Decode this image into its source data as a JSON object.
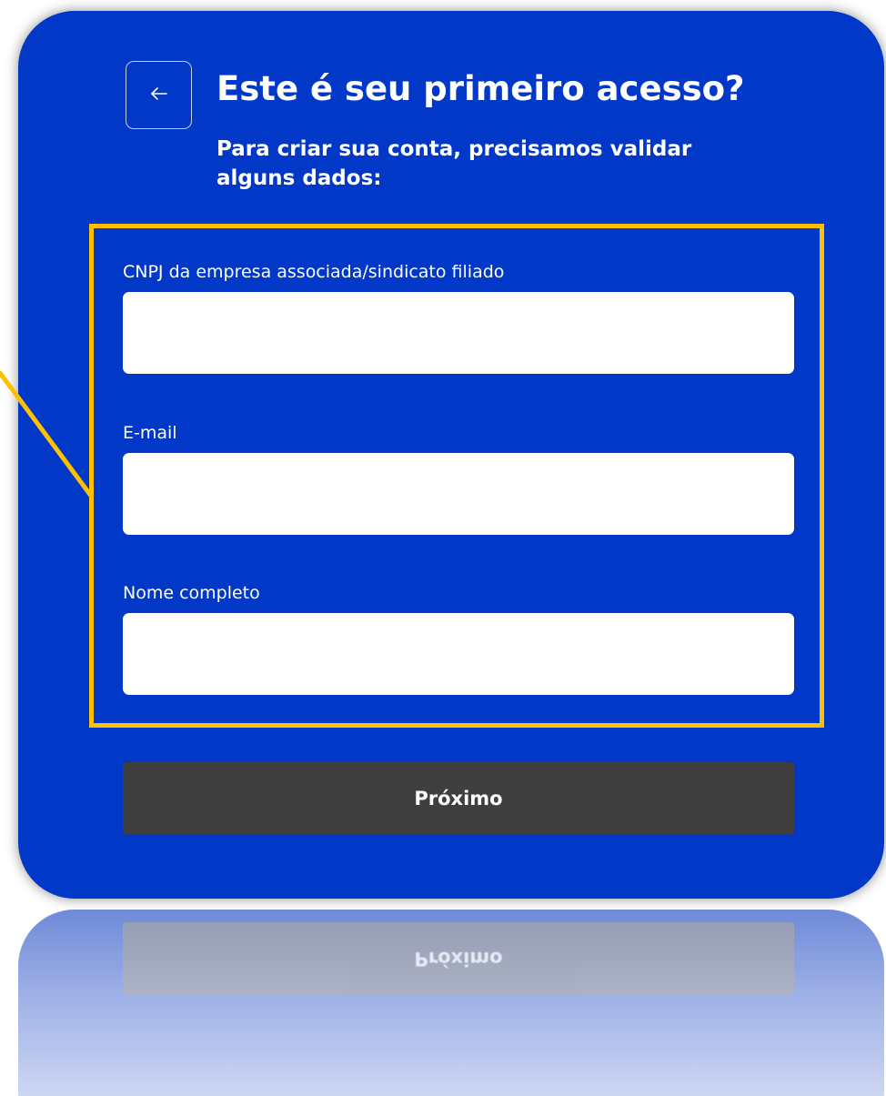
{
  "header": {
    "back_icon": "arrow-left-icon",
    "title": "Este é seu primeiro acesso?",
    "subtitle": "Para criar sua conta, precisamos validar alguns dados:"
  },
  "form": {
    "fields": [
      {
        "label": "CNPJ da empresa associada/sindicato filiado",
        "value": ""
      },
      {
        "label": "E-mail",
        "value": ""
      },
      {
        "label": "Nome completo",
        "value": ""
      }
    ],
    "next_label": "Próximo"
  },
  "colors": {
    "card_background": "#0138c8",
    "highlight_border": "#ffc000",
    "button_background": "#3f3f3f",
    "input_background": "#ffffff",
    "text": "#ffffff"
  }
}
